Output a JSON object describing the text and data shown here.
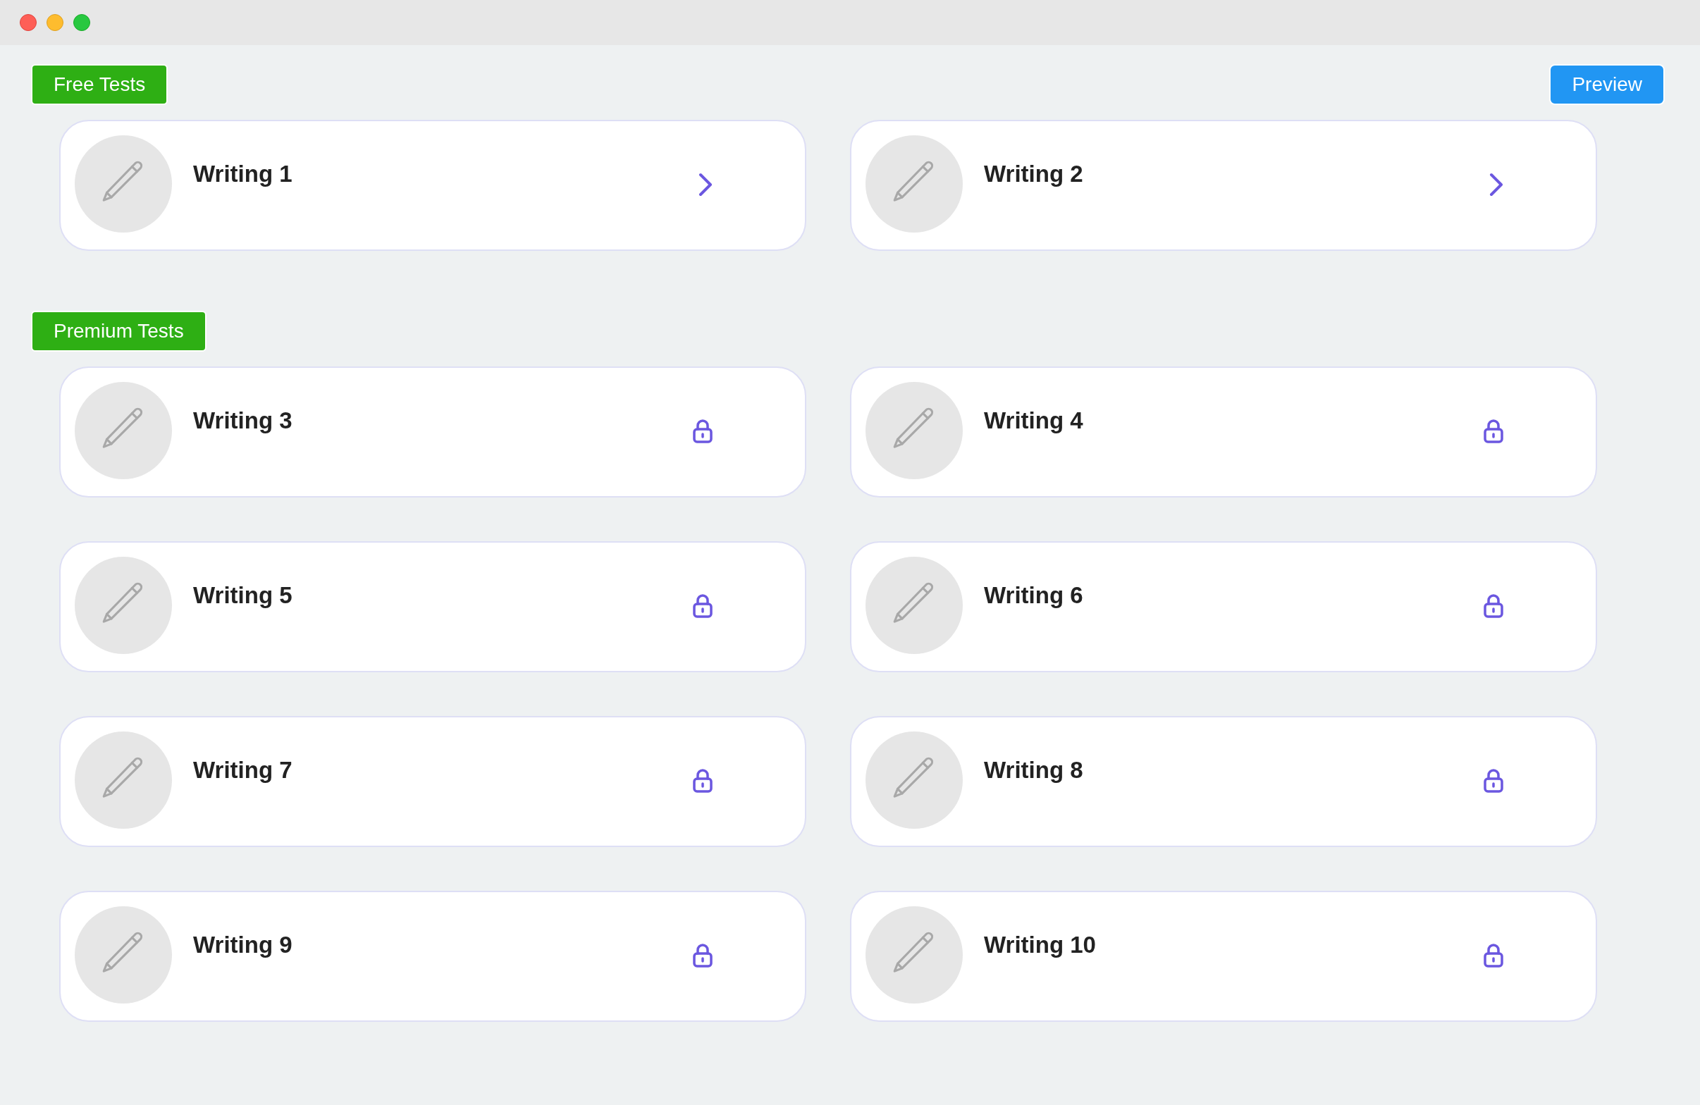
{
  "preview_button": "Preview",
  "sections": [
    {
      "label": "Free Tests",
      "tests": [
        {
          "title": "Writing 1",
          "kind": "open"
        },
        {
          "title": "Writing 2",
          "kind": "open"
        }
      ]
    },
    {
      "label": "Premium Tests",
      "tests": [
        {
          "title": "Writing 3",
          "kind": "locked"
        },
        {
          "title": "Writing 4",
          "kind": "locked"
        },
        {
          "title": "Writing 5",
          "kind": "locked"
        },
        {
          "title": "Writing 6",
          "kind": "locked"
        },
        {
          "title": "Writing 7",
          "kind": "locked"
        },
        {
          "title": "Writing 8",
          "kind": "locked"
        },
        {
          "title": "Writing 9",
          "kind": "locked"
        },
        {
          "title": "Writing 10",
          "kind": "locked"
        }
      ]
    }
  ]
}
